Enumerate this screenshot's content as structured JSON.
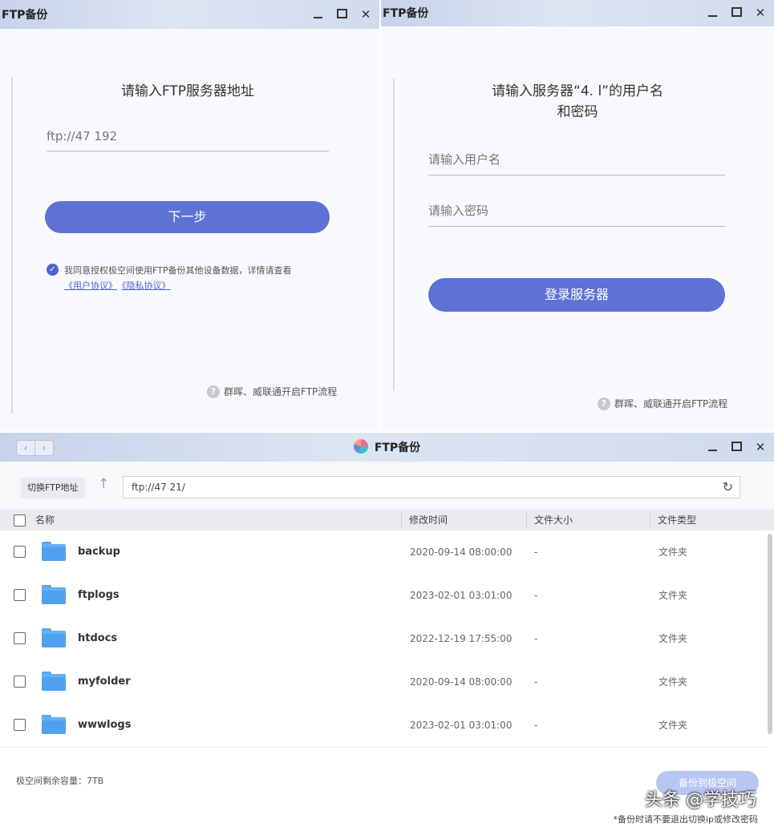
{
  "login_step1": {
    "title": "FTP备份",
    "heading": "请输入FTP服务器地址",
    "address_value": "ftp://47      192",
    "next_label": "下一步",
    "agreement_text": "我同意授权极空间使用FTP备份其他设备数据，详情请查看",
    "user_agreement_link": "《用户协议》",
    "privacy_link": "《隐私协议》",
    "help_text": "群晖、威联通开启FTP流程"
  },
  "login_step2": {
    "title": "FTP备份",
    "heading_line1": "请输入服务器“4.        l”的用户名",
    "heading_line2": "和密码",
    "username_placeholder": "请输入用户名",
    "password_placeholder": "请输入密码",
    "login_label": "登录服务器",
    "help_text": "群晖、威联通开启FTP流程"
  },
  "browser": {
    "title": "FTP备份",
    "switch_label": "切换FTP地址",
    "path_value": "ftp://47          21/",
    "columns": {
      "name": "名称",
      "modified": "修改时间",
      "size": "文件大小",
      "type": "文件类型"
    },
    "rows": [
      {
        "name": "backup",
        "modified": "2020-09-14 08:00:00",
        "size": "-",
        "type": "文件夹"
      },
      {
        "name": "ftplogs",
        "modified": "2023-02-01 03:01:00",
        "size": "-",
        "type": "文件夹"
      },
      {
        "name": "htdocs",
        "modified": "2022-12-19 17:55:00",
        "size": "-",
        "type": "文件夹"
      },
      {
        "name": "myfolder",
        "modified": "2020-09-14 08:00:00",
        "size": "-",
        "type": "文件夹"
      },
      {
        "name": "wwwlogs",
        "modified": "2023-02-01 03:01:00",
        "size": "-",
        "type": "文件夹"
      }
    ],
    "capacity_text": "极空间剩余容量：7TB",
    "backup_label": "备份到极空间",
    "notice_text": "*备份时请不要退出切换ip或修改密码"
  },
  "watermark_text": "头条 @学技巧",
  "colors": {
    "primary": "#5d72d4",
    "folder": "#4fa0ef",
    "titlebar": "#c7d3ea"
  },
  "icons": [
    "minimize-icon",
    "maximize-icon",
    "close-icon",
    "check-icon",
    "help-icon",
    "folder-icon",
    "refresh-icon",
    "up-arrow-icon",
    "back-icon",
    "forward-icon"
  ]
}
